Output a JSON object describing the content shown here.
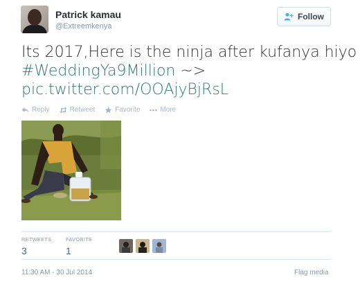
{
  "author": {
    "name": "Patrick kamau",
    "handle": "@Extreemkenya"
  },
  "follow_button": {
    "label": "Follow",
    "icon": "add-user-icon"
  },
  "tweet": {
    "line1": "Its 2017,Here is the ninja after kufanya hiyo",
    "hashtag": "#WeddingYa9Million",
    "after_hashtag": " ~>",
    "link": "pic.twitter.com/OOAjyBjRsL"
  },
  "actions": [
    {
      "label": "Reply",
      "icon": "reply-icon"
    },
    {
      "label": "Retweet",
      "icon": "retweet-icon"
    },
    {
      "label": "Favorite",
      "icon": "star-icon"
    },
    {
      "label": "More",
      "icon": "more-dots-icon"
    }
  ],
  "stats": {
    "retweets_label": "RETWEETS",
    "retweets_value": "3",
    "favorites_label": "FAVORITE",
    "favorites_value": "1"
  },
  "timestamp": "11:30 AM - 30 Jul 2014",
  "flag_media": "Flag media",
  "colors": {
    "link": "#2f7a6e",
    "muted": "#8899a6",
    "text": "#292f33"
  }
}
